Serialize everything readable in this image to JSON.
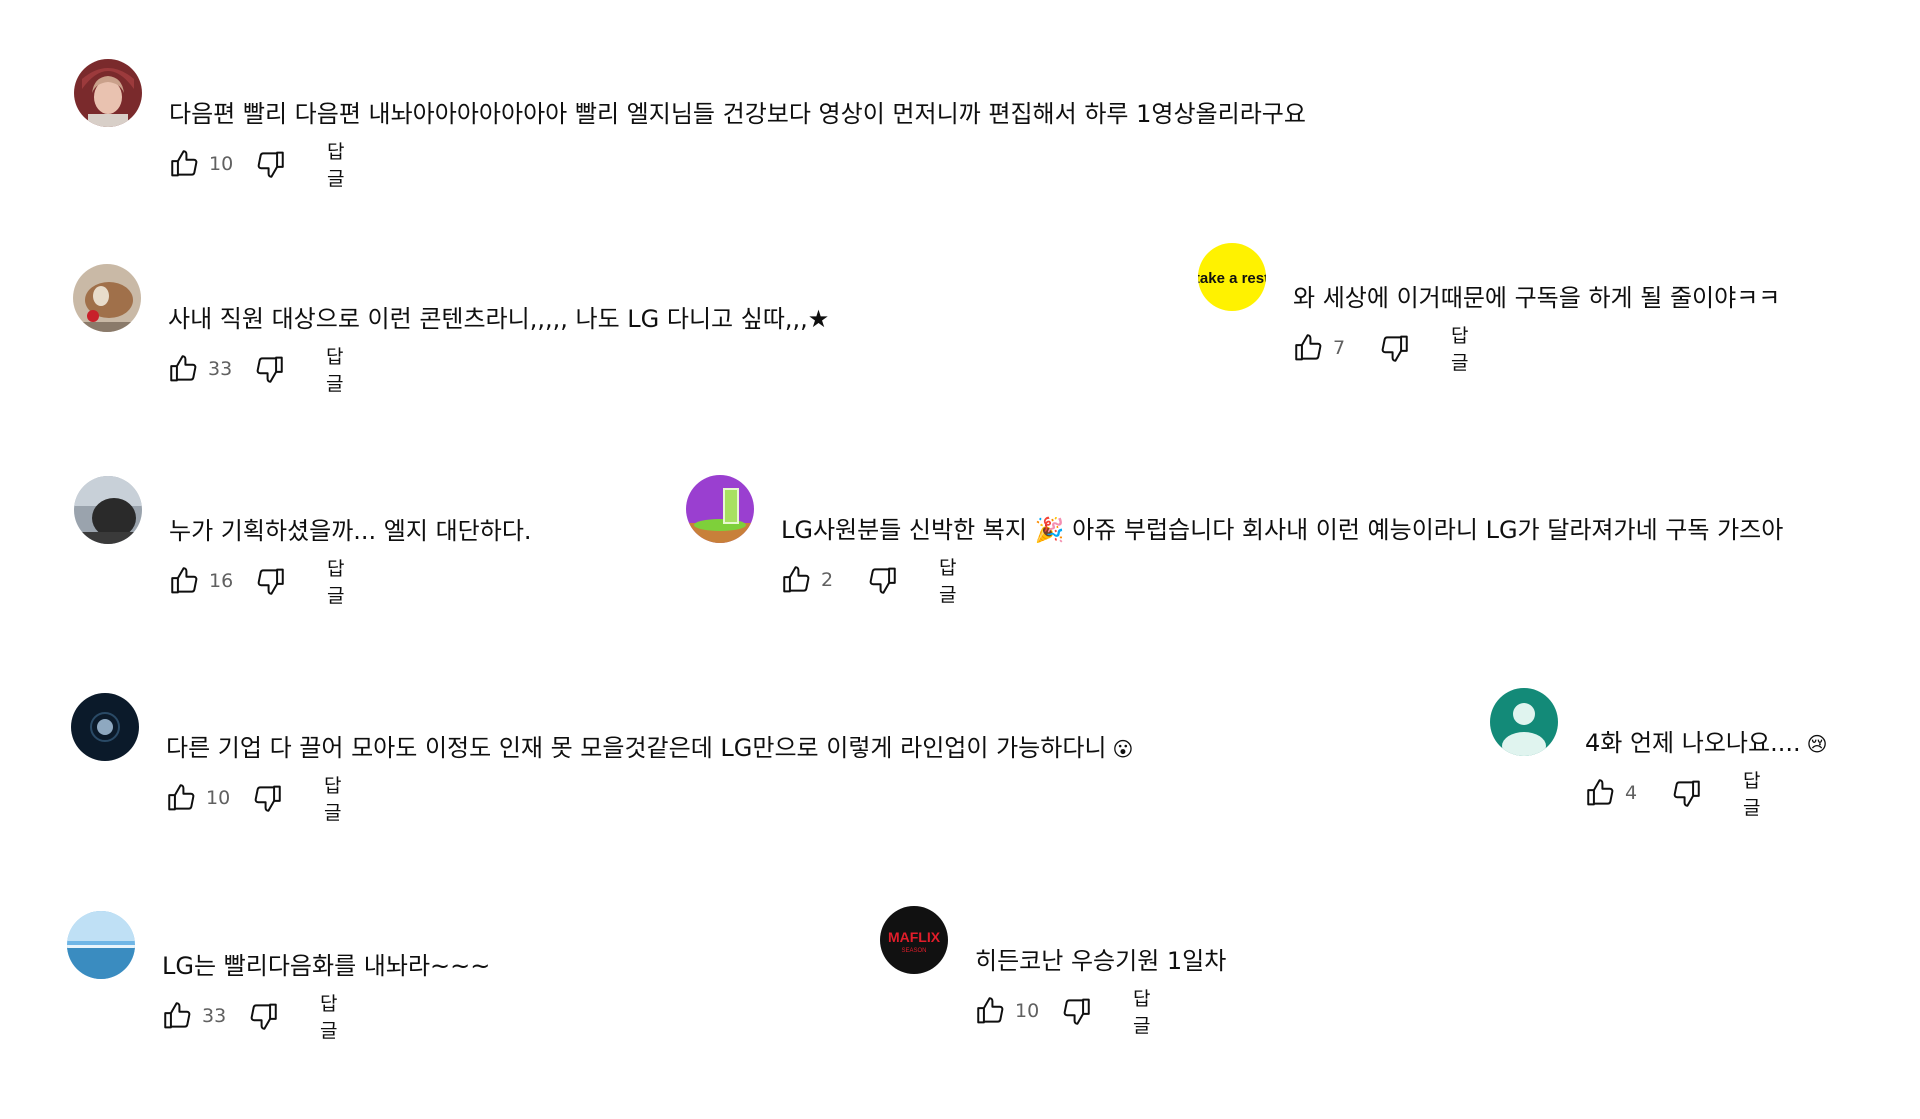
{
  "comments": [
    {
      "avatar": "portrait-woman-red-hat",
      "text": "다음편 빨리 다음편 내놔아아아아아아아 빨리 엘지님들 건강보다 영상이 먼저니까 편집해서 하루 1영상올리라구요",
      "likes": "10",
      "reply_label": "답글"
    },
    {
      "avatar": "dog-photo",
      "text": "사내 직원 대상으로 이런 콘텐츠라니,,,,, 나도 LG 다니고 싶따,,,★",
      "likes": "33",
      "reply_label": "답글"
    },
    {
      "avatar": "take-a-rest-logo",
      "avatar_text": "take a rest",
      "text": "와 세상에 이거때문에 구독을 하게 될 줄이야ㅋㅋ",
      "likes": "7",
      "reply_label": "답글"
    },
    {
      "avatar": "silhouette-sky-photo",
      "text": "누가 기획하셨을까... 엘지 대단하다.",
      "likes": "16",
      "reply_label": "답글"
    },
    {
      "avatar": "green-drink-on-purple",
      "text": "LG사원분들 신박한 복지 🎉 아쥬 부럽습니다 회사내 이런 예능이라니  LG가 달라져가네 구독 가즈아",
      "likes": "2",
      "reply_label": "답글"
    },
    {
      "avatar": "moon-night-photo",
      "text": "다른 기업 다 끌어 모아도 이정도 인재 못 모을것같은데 LG만으로 이렇게 라인업이 가능하다니",
      "emoji": "😮",
      "likes": "10",
      "reply_label": "답글"
    },
    {
      "avatar": "default-user-teal",
      "text": "4화 언제 나오나요....",
      "emoji": "😢",
      "likes": "4",
      "reply_label": "답글"
    },
    {
      "avatar": "blue-sea-photo",
      "text": "LG는 빨리다음화를 내놔라~~~",
      "likes": "33",
      "reply_label": "답글"
    },
    {
      "avatar": "maflix-logo",
      "avatar_text": "MAFLIX",
      "avatar_subtext": "SEASON",
      "text": "히든코난 우승기원 1일차",
      "likes": "10",
      "reply_label": "답글"
    }
  ],
  "colors": {
    "text": "#0f0f0f",
    "secondary": "#606060",
    "teal_avatar": "#138a78",
    "take_a_rest_bg": "#fff200"
  }
}
